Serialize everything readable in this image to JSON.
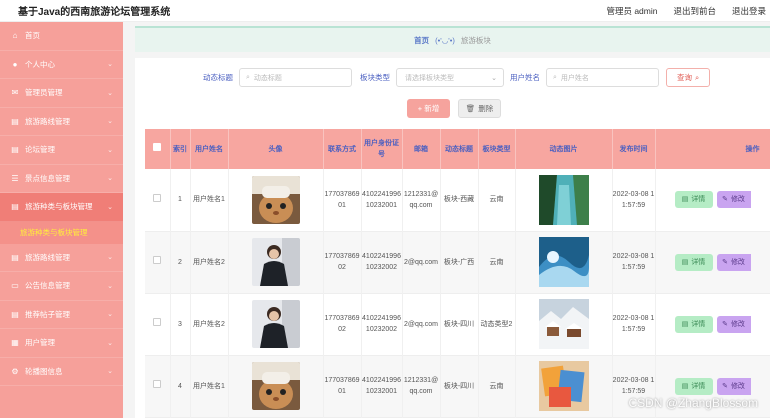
{
  "header": {
    "title": "基于Java的西南旅游论坛管理系统",
    "user_label": "管理员 admin",
    "front_link": "退出到前台",
    "logout_link": "退出登录"
  },
  "sidebar": {
    "items": [
      {
        "label": "首页",
        "icon": "home-icon",
        "has_arrow": false
      },
      {
        "label": "个人中心",
        "icon": "user-icon",
        "has_arrow": true
      },
      {
        "label": "管理员管理",
        "icon": "mail-icon",
        "has_arrow": true
      },
      {
        "label": "旅游路线管理",
        "icon": "doc-icon",
        "has_arrow": true
      },
      {
        "label": "论坛管理",
        "icon": "doc-icon",
        "has_arrow": true
      },
      {
        "label": "景点信息管理",
        "icon": "menu-icon",
        "has_arrow": true
      },
      {
        "label": "旅游种类与板块管理",
        "icon": "doc-icon",
        "has_arrow": true,
        "active": true
      },
      {
        "label": "旅游路线管理",
        "icon": "doc-icon",
        "has_arrow": true
      },
      {
        "label": "公告信息管理",
        "icon": "chat-icon",
        "has_arrow": true
      },
      {
        "label": "推荐帖子管理",
        "icon": "doc-icon",
        "has_arrow": true
      },
      {
        "label": "用户管理",
        "icon": "chart-icon",
        "has_arrow": true
      },
      {
        "label": "轮播图信息",
        "icon": "gear-icon",
        "has_arrow": true
      }
    ],
    "submenu_label": "旅游种类与板块管理"
  },
  "breadcrumb": {
    "home": "首页",
    "face": "(•'◡'•)",
    "current": "旅游板块"
  },
  "search": {
    "title_label": "动态标题",
    "title_placeholder": "动态标题",
    "type_label": "板块类型",
    "type_placeholder": "请选择板块类型",
    "name_label": "用户姓名",
    "name_placeholder": "用户姓名",
    "query_button": "查询"
  },
  "actions": {
    "add": "+ 新增",
    "delete": "删除"
  },
  "table": {
    "headers": [
      "索引",
      "用户姓名",
      "头像",
      "联系方式",
      "用户身份证号",
      "邮箱",
      "动态标题",
      "板块类型",
      "动态图片",
      "发布时间",
      "操作"
    ],
    "rows": [
      {
        "index": "1",
        "name": "用户姓名1",
        "avatar": "cat",
        "phone": "17703786901",
        "id_no": "410224199610232001",
        "email": "1212331@qq.com",
        "title": "板块-西藏",
        "type": "云南",
        "pic": "river",
        "time": "2022-03-08 11:57:59"
      },
      {
        "index": "2",
        "name": "用户姓名2",
        "avatar": "person",
        "phone": "17703786902",
        "id_no": "410224199610232002",
        "email": "2@qq.com",
        "title": "板块-广西",
        "type": "云南",
        "pic": "wave",
        "time": "2022-03-08 11:57:59"
      },
      {
        "index": "3",
        "name": "用户姓名2",
        "avatar": "person",
        "phone": "17703786902",
        "id_no": "410224199610232002",
        "email": "2@qq.com",
        "title": "板块-四川",
        "type": "动态类型2",
        "pic": "snow",
        "time": "2022-03-08 11:57:59"
      },
      {
        "index": "4",
        "name": "用户姓名1",
        "avatar": "cat",
        "phone": "17703786901",
        "id_no": "410224199610232001",
        "email": "1212331@qq.com",
        "title": "板块-四川",
        "type": "云南",
        "pic": "cards",
        "time": "2022-03-08 11:57:59"
      }
    ],
    "detail_button": "详情",
    "edit_button": "修改"
  },
  "watermark": "CSDN @ZhangBlossom"
}
